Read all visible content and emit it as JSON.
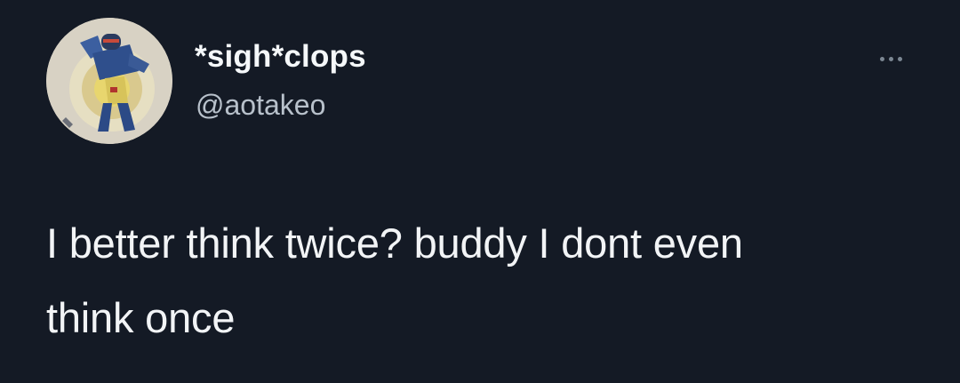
{
  "tweet": {
    "author": {
      "display_name": "*sigh*clops",
      "handle": "@aotakeo",
      "avatar_icon": "cyclops-character-avatar"
    },
    "more_icon": "more-horizontal-icon",
    "text_lines": [
      "I better think twice? buddy I dont even",
      "think once"
    ]
  },
  "colors": {
    "background": "#141a25",
    "primary_text": "#f2f4f6",
    "secondary_text": "#b8c1cb",
    "icon_muted": "#7c8793"
  }
}
